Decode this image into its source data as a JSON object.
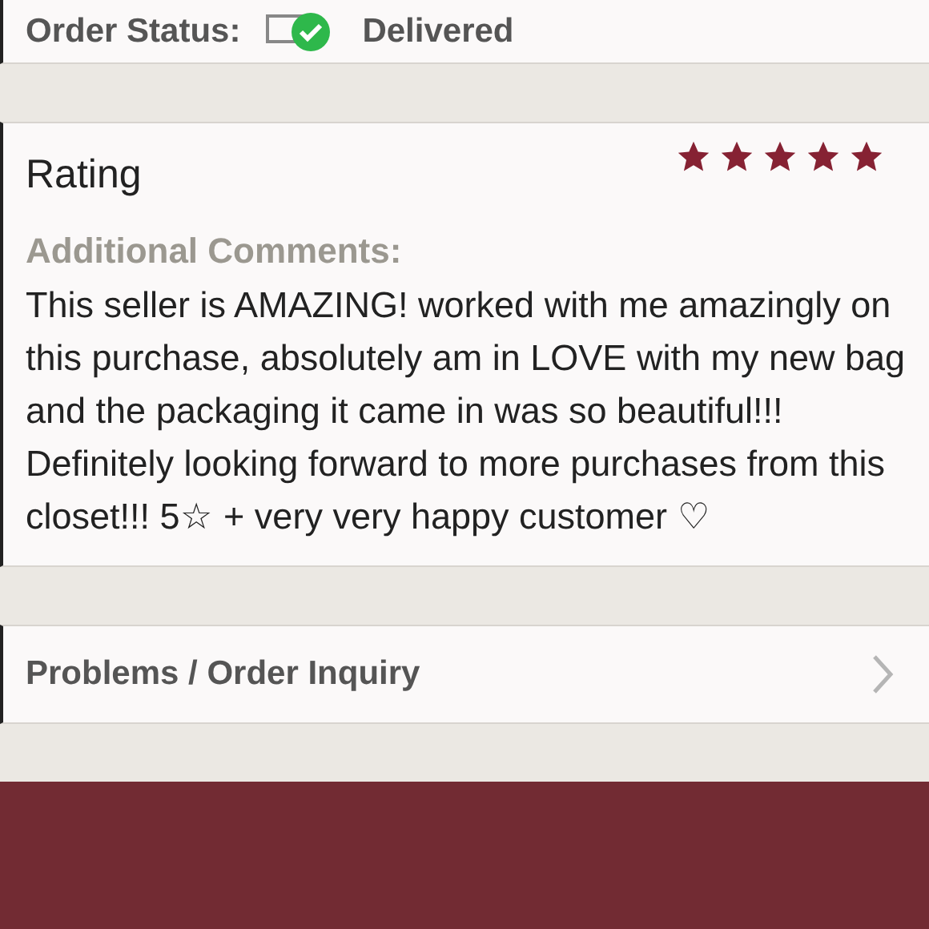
{
  "order_status": {
    "label": "Order Status:",
    "value": "Delivered"
  },
  "rating": {
    "title": "Rating",
    "stars": 5,
    "comments_label": "Additional Comments:",
    "comments": "This seller is AMAZING! worked with me amazingly on this purchase, absolutely am in LOVE with my new bag and the packaging it came in was so beautiful!!! Definitely looking forward to more purchases from this closet!!! 5☆ + very very happy customer ♡"
  },
  "inquiry": {
    "label": "Problems / Order Inquiry"
  }
}
